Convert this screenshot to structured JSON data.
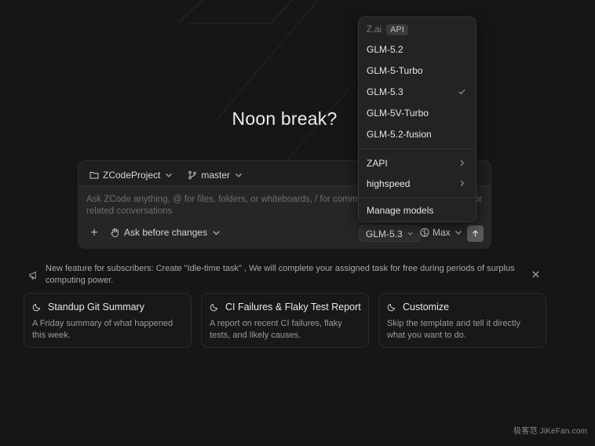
{
  "greeting": "Noon break?",
  "composer": {
    "project": "ZCodeProject",
    "branch": "master",
    "placeholder": "Ask ZCode anything, @ for files, folders, or whiteboards, / for commands, # for related conversations",
    "placeholder_line1": "Ask ZCode anything, @ for files, folders, or whiteboards, / for comma",
    "placeholder_end": "or",
    "placeholder_line2": "related conversations",
    "add_label": "+",
    "mode_label": "Ask before changes",
    "model_label": "GLM-5.3",
    "effort_label": "Max"
  },
  "model_menu": {
    "provider": "Z.ai",
    "provider_badge": "API",
    "models": [
      {
        "label": "GLM-5.2",
        "selected": false
      },
      {
        "label": "GLM-5-Turbo",
        "selected": false
      },
      {
        "label": "GLM-5.3",
        "selected": true
      },
      {
        "label": "GLM-5V-Turbo",
        "selected": false
      },
      {
        "label": "GLM-5.2-fusion",
        "selected": false
      }
    ],
    "submenus": [
      {
        "label": "ZAPI"
      },
      {
        "label": "highspeed"
      }
    ],
    "manage_label": "Manage models"
  },
  "notice": {
    "line1": "New feature for subscribers: Create \"Idle-time task\" , We will complete your assigned task for free during periods of surplus",
    "line2": "computing power."
  },
  "cards": [
    {
      "title": "Standup Git Summary",
      "desc": "A Friday summary of what happened this week."
    },
    {
      "title": "CI Failures & Flaky Test Report",
      "desc": "A report on recent CI failures, flaky tests, and likely causes."
    },
    {
      "title": "Customize",
      "desc": "Skip the template and tell it directly what you want to do."
    }
  ],
  "watermark": "极客范 JiKeFan.com",
  "colors": {
    "background": "#161616",
    "panel": "#232323",
    "accent_muted": "#5a5a5a"
  }
}
